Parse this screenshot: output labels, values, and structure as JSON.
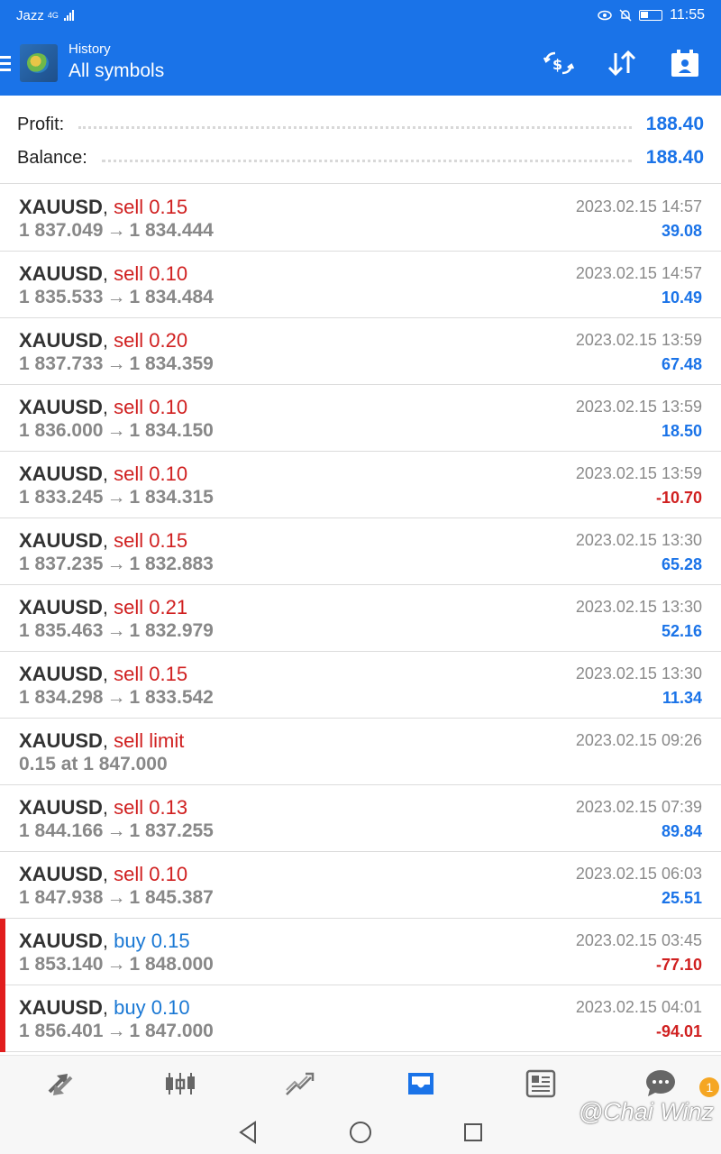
{
  "status_bar": {
    "carrier": "Jazz",
    "network": "4G",
    "time": "11:55",
    "icons": [
      "eye-icon",
      "mute-bell-icon",
      "battery-icon"
    ]
  },
  "app_bar": {
    "subtitle": "History",
    "title": "All symbols",
    "actions": [
      "currency-exchange-icon",
      "sort-icon",
      "calendar-icon"
    ]
  },
  "summary": {
    "profit_label": "Profit:",
    "profit_value": "188.40",
    "balance_label": "Balance:",
    "balance_value": "188.40"
  },
  "trades": [
    {
      "symbol": "XAUUSD",
      "side": "sell 0.15",
      "type": "sell",
      "open": "1 837.049",
      "close": "1 834.444",
      "time": "2023.02.15 14:57",
      "profit": "39.08",
      "sign": "pos"
    },
    {
      "symbol": "XAUUSD",
      "side": "sell 0.10",
      "type": "sell",
      "open": "1 835.533",
      "close": "1 834.484",
      "time": "2023.02.15 14:57",
      "profit": "10.49",
      "sign": "pos"
    },
    {
      "symbol": "XAUUSD",
      "side": "sell 0.20",
      "type": "sell",
      "open": "1 837.733",
      "close": "1 834.359",
      "time": "2023.02.15 13:59",
      "profit": "67.48",
      "sign": "pos"
    },
    {
      "symbol": "XAUUSD",
      "side": "sell 0.10",
      "type": "sell",
      "open": "1 836.000",
      "close": "1 834.150",
      "time": "2023.02.15 13:59",
      "profit": "18.50",
      "sign": "pos"
    },
    {
      "symbol": "XAUUSD",
      "side": "sell 0.10",
      "type": "sell",
      "open": "1 833.245",
      "close": "1 834.315",
      "time": "2023.02.15 13:59",
      "profit": "-10.70",
      "sign": "neg"
    },
    {
      "symbol": "XAUUSD",
      "side": "sell 0.15",
      "type": "sell",
      "open": "1 837.235",
      "close": "1 832.883",
      "time": "2023.02.15 13:30",
      "profit": "65.28",
      "sign": "pos"
    },
    {
      "symbol": "XAUUSD",
      "side": "sell 0.21",
      "type": "sell",
      "open": "1 835.463",
      "close": "1 832.979",
      "time": "2023.02.15 13:30",
      "profit": "52.16",
      "sign": "pos"
    },
    {
      "symbol": "XAUUSD",
      "side": "sell 0.15",
      "type": "sell",
      "open": "1 834.298",
      "close": "1 833.542",
      "time": "2023.02.15 13:30",
      "profit": "11.34",
      "sign": "pos"
    },
    {
      "symbol": "XAUUSD",
      "side": "sell limit",
      "type": "sell",
      "order_text": "0.15 at 1 847.000",
      "time": "2023.02.15 09:26",
      "profit": "",
      "sign": "pos"
    },
    {
      "symbol": "XAUUSD",
      "side": "sell 0.13",
      "type": "sell",
      "open": "1 844.166",
      "close": "1 837.255",
      "time": "2023.02.15 07:39",
      "profit": "89.84",
      "sign": "pos"
    },
    {
      "symbol": "XAUUSD",
      "side": "sell 0.10",
      "type": "sell",
      "open": "1 847.938",
      "close": "1 845.387",
      "time": "2023.02.15 06:03",
      "profit": "25.51",
      "sign": "pos"
    },
    {
      "symbol": "XAUUSD",
      "side": "buy 0.15",
      "type": "buy",
      "open": "1 853.140",
      "close": "1 848.000",
      "time": "2023.02.15 03:45",
      "profit": "-77.10",
      "sign": "neg",
      "marker": true
    },
    {
      "symbol": "XAUUSD",
      "side": "buy 0.10",
      "type": "buy",
      "open": "1 856.401",
      "close": "1 847.000",
      "time": "2023.02.15 04:01",
      "profit": "-94.01",
      "sign": "neg",
      "marker": true
    }
  ],
  "arrow_glyph": "→",
  "comma": ",",
  "bottom_nav": {
    "items": [
      "quotes-icon",
      "chart-icon",
      "trade-icon",
      "history-icon",
      "news-icon",
      "chat-icon"
    ],
    "active": "history-icon",
    "chat_badge": "1"
  },
  "watermark": "@Chai Winz",
  "colors": {
    "accent": "#1a73e8",
    "sell": "#d02020",
    "buy": "#1a78d4",
    "loss_marker": "#e11d1d"
  }
}
